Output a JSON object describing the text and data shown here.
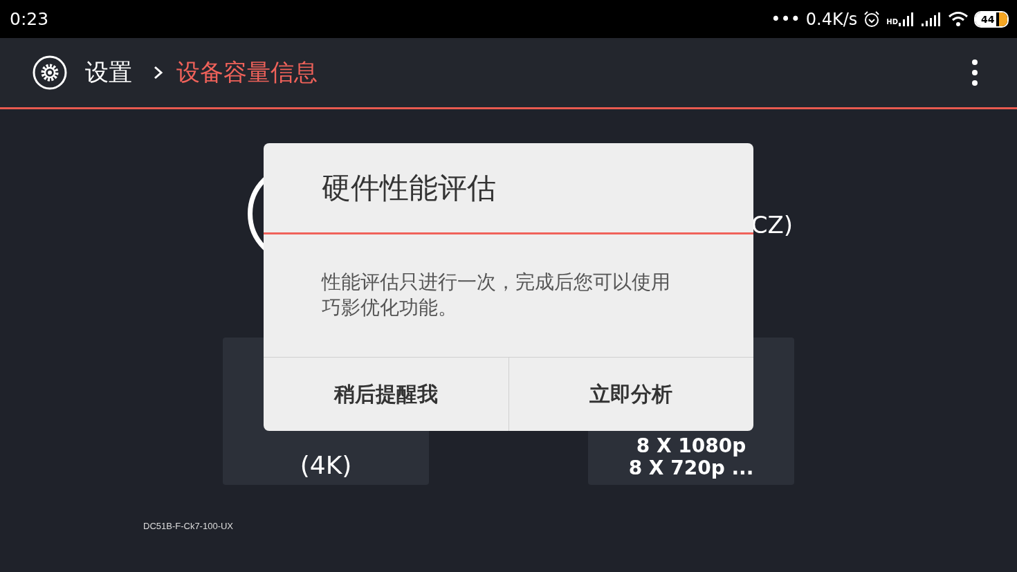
{
  "status_bar": {
    "time": "0:23",
    "overflow": "•••",
    "speed": "0.4K/s",
    "signal_label": "HD",
    "battery": "44"
  },
  "header": {
    "crumbs": [
      {
        "label": "设置",
        "selected": false
      },
      {
        "label": "设备容量信息",
        "selected": true
      }
    ]
  },
  "background": {
    "device_name_tail": "CZ)",
    "cards": [
      {
        "lines": [
          "(4K)"
        ]
      },
      {
        "lines": [
          "8 X 1080p",
          "8 X 720p ..."
        ]
      }
    ],
    "footer_code": "DC51B-F-Ck7-100-UX"
  },
  "dialog": {
    "title": "硬件性能评估",
    "message": "性能评估只进行一次，完成后您可以使用巧影优化功能。",
    "buttons": [
      "稍后提醒我",
      "立即分析"
    ]
  }
}
